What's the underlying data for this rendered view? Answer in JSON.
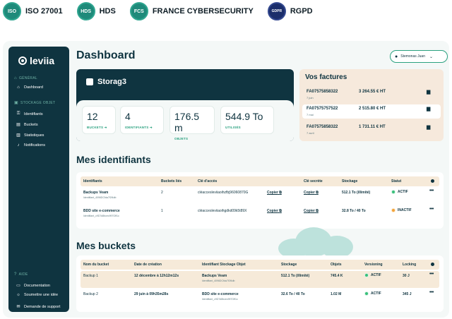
{
  "certifications": [
    {
      "badge": "ISO",
      "label": "ISO 27001",
      "icon": "iso-badge-icon"
    },
    {
      "badge": "HDS",
      "label": "HDS",
      "icon": "hds-badge-icon"
    },
    {
      "badge": "FCS",
      "label": "FRANCE CYBERSECURITY",
      "icon": "france-cybersecurity-badge-icon"
    },
    {
      "badge": "GDPR",
      "label": "RGPD",
      "icon": "gdpr-badge-icon"
    }
  ],
  "sidebar": {
    "logo": "leviia",
    "section_general": "GÉNÉRAL",
    "section_storage": "STOCKAGE OBJET",
    "section_help": "AIDE",
    "items": [
      {
        "label": "Dashboard",
        "icon": "home-icon"
      },
      {
        "label": "Identifiants",
        "icon": "key-icon"
      },
      {
        "label": "Buckets",
        "icon": "bucket-icon"
      },
      {
        "label": "Statistiques",
        "icon": "chart-icon"
      },
      {
        "label": "Notifications",
        "icon": "bell-icon"
      },
      {
        "label": "Documentation",
        "icon": "book-icon"
      },
      {
        "label": "Soumettre une idée",
        "icon": "bulb-icon"
      },
      {
        "label": "Demande de support",
        "icon": "chat-icon"
      }
    ]
  },
  "header": {
    "title": "Dashboard",
    "user_name": "Stemonas Juan"
  },
  "storage_card": {
    "name": "Storag3",
    "stats": [
      {
        "value": "12",
        "caption": "BUCKETS ➜"
      },
      {
        "value": "4",
        "caption": "IDENTIFIANTS ➜"
      },
      {
        "value": "176.5 m",
        "caption": "OBJETS"
      },
      {
        "value": "544.9 To",
        "caption": "UTILISÉS"
      }
    ]
  },
  "invoices": {
    "title": "Vos factures",
    "rows": [
      {
        "id": "FA07575858322",
        "date": "7 juin",
        "amount": "3 264.55 € HT"
      },
      {
        "id": "FA07575757522",
        "date": "7 mai",
        "amount": "2 515.80 € HT"
      },
      {
        "id": "FA07575858322",
        "date": "7 avril",
        "amount": "1 731.11 € HT"
      }
    ]
  },
  "identifiers": {
    "title": "Mes identifiants",
    "columns": [
      "Identifiants",
      "Buckets liés",
      "Clé d'accès",
      "Clé secrète",
      "Stockage",
      "Statut"
    ],
    "copy_label": "Copier",
    "rows": [
      {
        "name": "Backups Veam",
        "sub": "Identifiant_4096DCfda7f2f4db",
        "buckets": "2",
        "access_key": "cléaccesleviiaoihzfbj96060870G",
        "storage": "512.1 To (illimité)",
        "status": "ACTIF",
        "status_color": "#39c07a"
      },
      {
        "name": "BDD site e-commerce",
        "sub": "Identifiant_c9D7d8bcec997Gff1c",
        "buckets": "1",
        "access_key": "cléaccesleviiaoihgdkd09k5t89X",
        "storage": "32.8 To / 40 To",
        "status": "INACTIF",
        "status_color": "#f2a33a"
      }
    ]
  },
  "buckets": {
    "title": "Mes buckets",
    "columns": [
      "Nom du bucket",
      "Date de création",
      "Identifiant Stockage Objet",
      "Stockage",
      "Objets",
      "Versioning",
      "Locking"
    ],
    "rows": [
      {
        "name": "Backup 1",
        "created": "12 décembre à 12h12m12s",
        "identifier": "Backups Veam",
        "identifier_sub": "Identifiant_4096DCfda7f2f4db",
        "storage": "512.1 To (illimité)",
        "objects": "745.4 K",
        "versioning": "ACTIF",
        "locking": "30 J"
      },
      {
        "name": "Backup 2",
        "created": "29 juin à 09h35m28s",
        "identifier": "BDD site e-commerce",
        "identifier_sub": "Identifiant_c9D7d8bcec997Gff1c",
        "storage": "32.6 To / 40 To",
        "objects": "1.02 M",
        "versioning": "ACTIF",
        "locking": "345 J"
      }
    ]
  },
  "colors": {
    "brand_dark": "#0f3440",
    "accent_green": "#2aa17f",
    "beige": "#f6e9dc",
    "active": "#39c07a",
    "inactive": "#f2a33a"
  }
}
